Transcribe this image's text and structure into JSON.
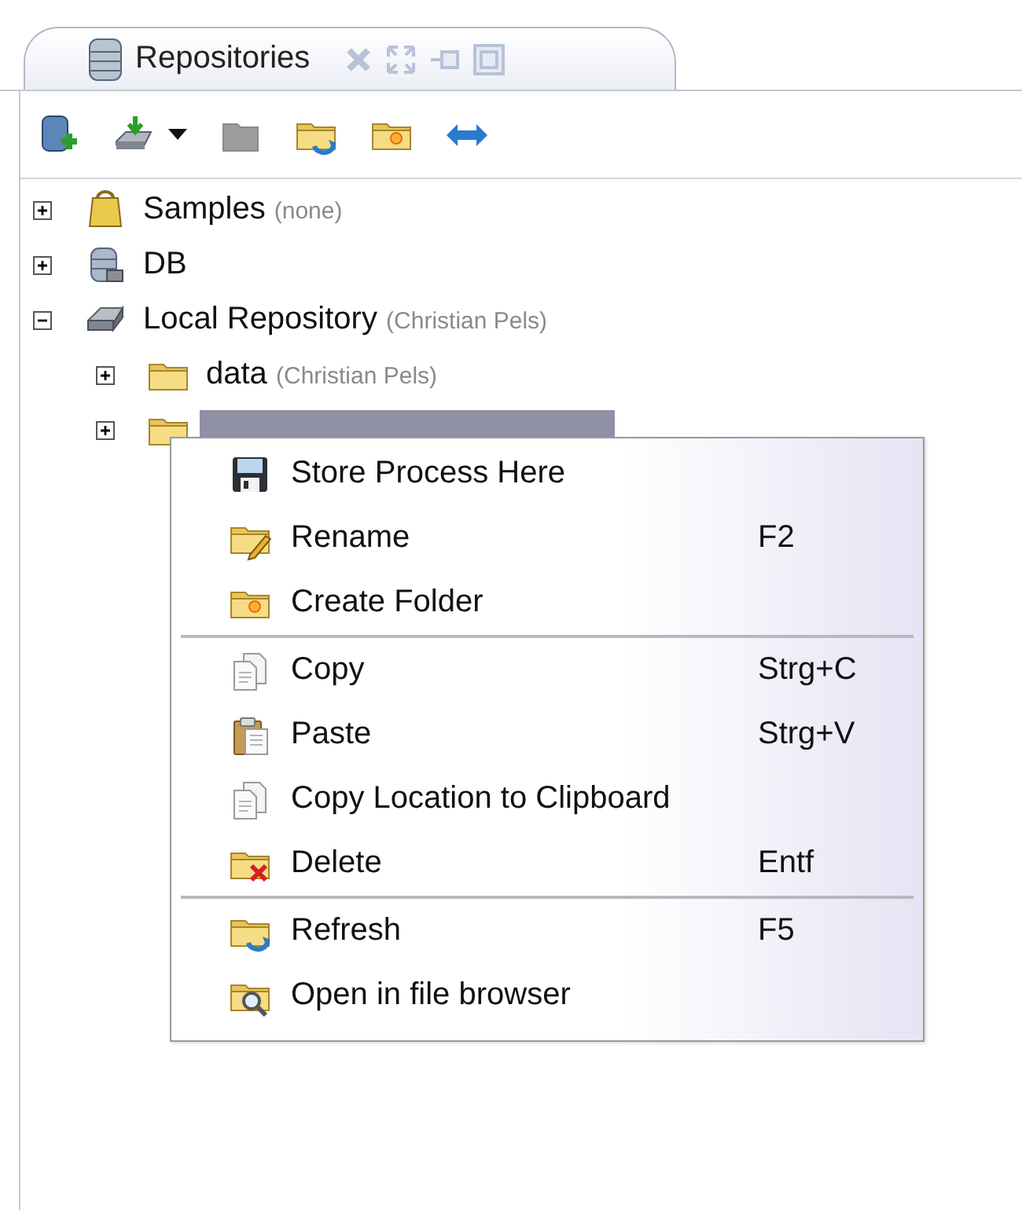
{
  "panel": {
    "title": "Repositories"
  },
  "tree": [
    {
      "kind": "samples",
      "label": "Samples",
      "owner": "(none)",
      "expanded": false,
      "selected": false
    },
    {
      "kind": "database",
      "label": "DB",
      "expanded": false,
      "selected": false
    },
    {
      "kind": "drive",
      "label": "Local Repository",
      "owner": "(Christian Pels)",
      "expanded": true,
      "selected": false,
      "children": [
        {
          "kind": "folder",
          "label": "data",
          "owner": "(Christian Pels)",
          "expanded": false,
          "selected": false
        },
        {
          "kind": "folder",
          "expanded": false,
          "selected": true
        }
      ]
    }
  ],
  "context_menu": {
    "groups": [
      [
        {
          "kind": "save",
          "label": "Store Process Here"
        },
        {
          "kind": "rename",
          "label": "Rename",
          "shortcut": "F2"
        },
        {
          "kind": "new-folder",
          "label": "Create Folder"
        }
      ],
      [
        {
          "kind": "copy",
          "label": "Copy",
          "shortcut": "Strg+C"
        },
        {
          "kind": "paste",
          "label": "Paste",
          "shortcut": "Strg+V"
        },
        {
          "kind": "copy",
          "label": "Copy Location to Clipboard"
        },
        {
          "kind": "delete",
          "label": "Delete",
          "shortcut": "Entf"
        }
      ],
      [
        {
          "kind": "refresh",
          "label": "Refresh",
          "shortcut": "F5"
        },
        {
          "kind": "browse",
          "label": "Open in file browser"
        }
      ]
    ]
  }
}
